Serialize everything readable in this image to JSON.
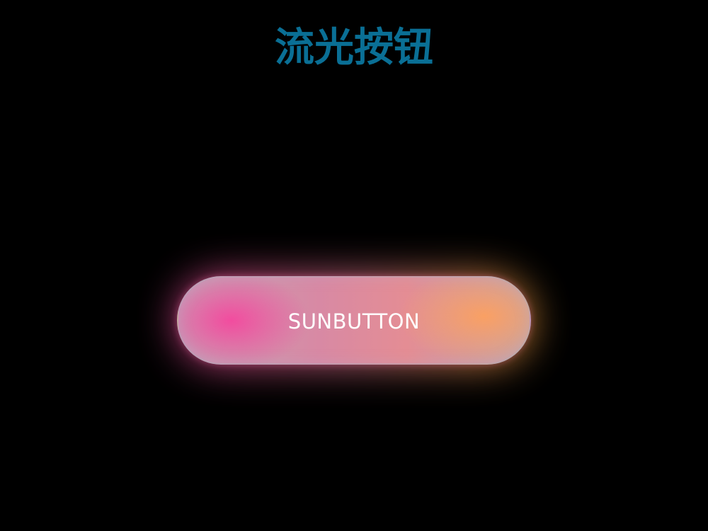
{
  "page": {
    "title": "流光按钮",
    "title_color": "#0a6f95",
    "background_color": "#000000"
  },
  "button": {
    "label": "SUNBUTTON",
    "gradient_colors": [
      "#f24aa0",
      "#ee7e96",
      "#ffa83c"
    ]
  }
}
